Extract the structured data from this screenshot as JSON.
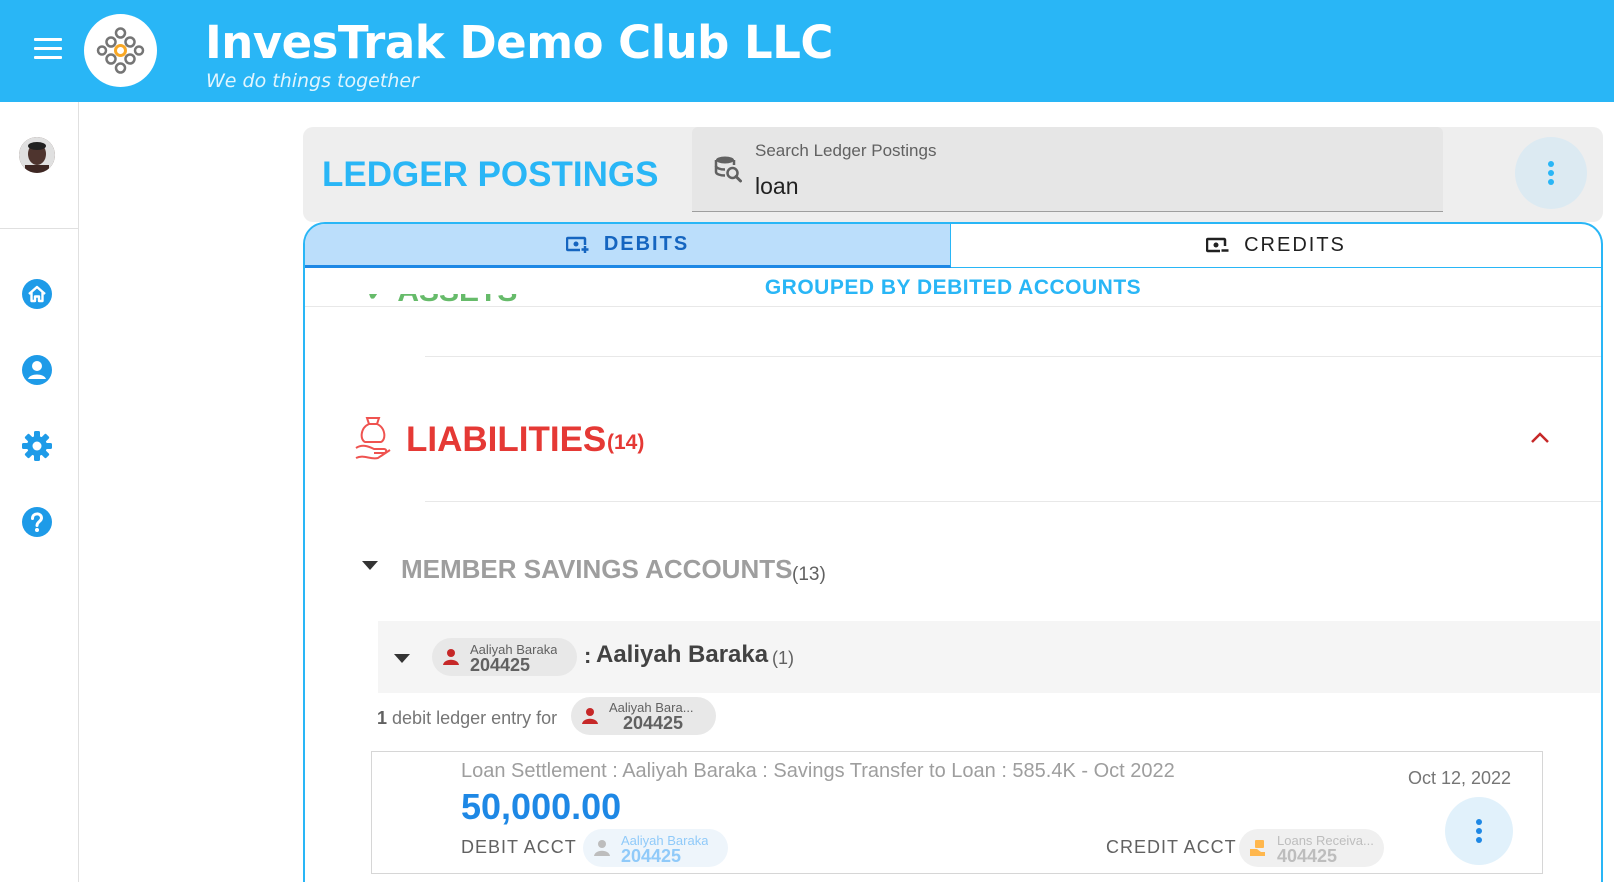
{
  "app": {
    "title": "InvesTrak Demo Club LLC",
    "subtitle": "We do things together"
  },
  "icons": {
    "menu": "hamburger-menu-icon",
    "logo": "club-logo-icon",
    "avatar": "user-avatar",
    "home": "home-icon",
    "profile": "account-circle-icon",
    "settings": "gear-icon",
    "help": "help-circle-icon",
    "search": "database-search-icon",
    "more": "more-vertical-icon",
    "liabilities": "hand-money-bag-icon",
    "person": "person-icon",
    "loan": "loan-hand-icon"
  },
  "header": {
    "title": "LEDGER POSTINGS",
    "search": {
      "label": "Search Ledger Postings",
      "value": "loan"
    }
  },
  "tabs": [
    {
      "label": "DEBITS",
      "active": true,
      "icon": "cash-plus-icon"
    },
    {
      "label": "CREDITS",
      "active": false,
      "icon": "cash-minus-icon"
    }
  ],
  "grouped_label": "GROUPED BY DEBITED ACCOUNTS",
  "liabilities": {
    "title": "LIABILITIES",
    "count": "(14)"
  },
  "member_savings": {
    "title": "MEMBER SAVINGS ACCOUNTS",
    "count": "(13)"
  },
  "member": {
    "chip_name": "Aaliyah Baraka",
    "chip_number": "204425",
    "separator": ":",
    "name": "Aaliyah Baraka",
    "count": "(1)"
  },
  "entry_summary": {
    "count": "1",
    "text": "debit ledger entry for",
    "chip_name": "Aaliyah Bara...",
    "chip_number": "204425"
  },
  "entry": {
    "description": "Loan Settlement : Aaliyah Baraka : Savings Transfer to Loan : 585.4K - Oct 2022",
    "date": "Oct 12, 2022",
    "amount": "50,000.00",
    "debit_label": "DEBIT ACCT :",
    "debit_chip_name": "Aaliyah Baraka",
    "debit_chip_number": "204425",
    "credit_label": "CREDIT ACCT :",
    "credit_chip_name": "Loans Receiva...",
    "credit_chip_number": "404425"
  },
  "colors": {
    "primary": "#29b6f6",
    "liabilities": "#e53935",
    "amount": "#1e88e5",
    "assets": "#66bb6a"
  }
}
